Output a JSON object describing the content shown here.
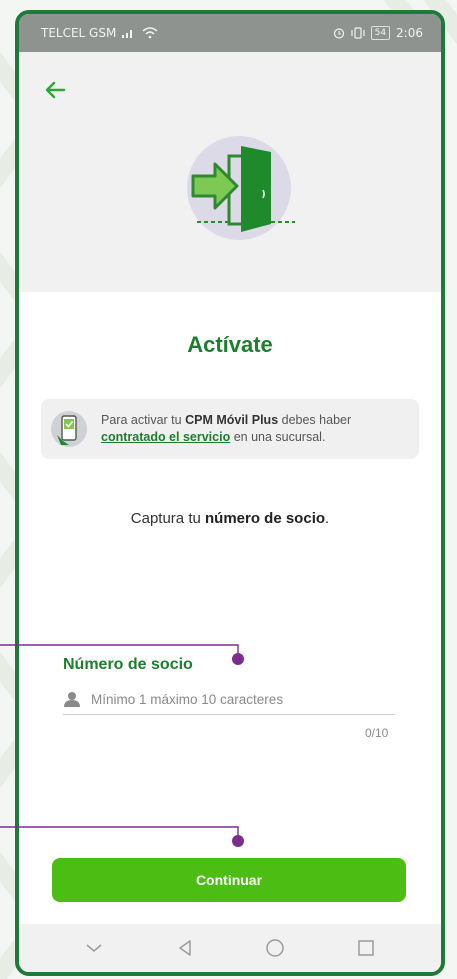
{
  "status_bar": {
    "carrier": "TELCEL GSM",
    "battery": "54",
    "time": "2:06"
  },
  "header": {
    "back_icon": "arrow-left-icon",
    "hero_icon": "door-enter-icon"
  },
  "title": "Actívate",
  "info_card": {
    "icon": "phone-check-icon",
    "text_before": "Para activar tu ",
    "text_bold": "CPM Móvil Plus",
    "text_after": " debes haber",
    "link": "contratado el servicio",
    "text_end": " en una sucursal."
  },
  "capture": {
    "text_before": "Captura tu ",
    "text_bold": "número de socio",
    "text_end": "."
  },
  "member_field": {
    "label": "Número de socio",
    "placeholder": "Mínimo 1 máximo 10 caracteres",
    "value": "",
    "counter": "0/10",
    "icon": "user-icon"
  },
  "continue_button": "Continuar",
  "nav": {
    "items": [
      "chevron-down-icon",
      "back-triangle-icon",
      "home-circle-icon",
      "recents-square-icon"
    ]
  },
  "colors": {
    "brand_green": "#1e7d2f",
    "button_green": "#4cbd13",
    "callout_purple": "#7b2d8e"
  }
}
